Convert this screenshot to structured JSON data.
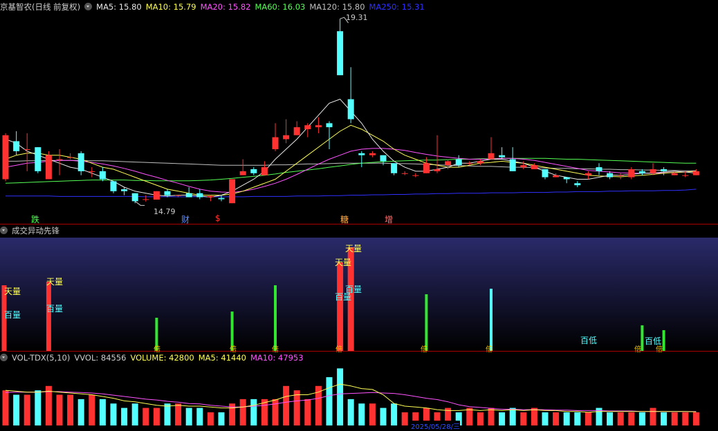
{
  "price_header": {
    "title": "京基智农(日线 前复权)",
    "ma5": "MA5: 15.80",
    "ma10": "MA10: 15.79",
    "ma20": "MA20: 15.82",
    "ma60": "MA60: 16.03",
    "ma120": "MA120: 15.80",
    "ma250": "MA250: 15.31"
  },
  "price_annotations": {
    "high": "19.31",
    "low": "14.79",
    "tags": [
      "跌",
      "财",
      "$",
      "糖",
      "增"
    ]
  },
  "indicator_header": {
    "title": "成交异动先锋"
  },
  "indicator_labels": {
    "tian": "天量",
    "bai": "百量",
    "bei": "倍",
    "baidi": "百低"
  },
  "volume_header": {
    "title": "VOL-TDX(5,10)",
    "vvol": "VVOL: 84556",
    "volume": "VOLUME: 42800",
    "ma5": "MA5: 41440",
    "ma10": "MA10: 47953"
  },
  "bottom_date": "2025/05/28/三",
  "colors": {
    "up": "#ff3232",
    "down": "#54ffff",
    "ma5": "#e8e8e8",
    "ma10": "#ffff54",
    "ma20": "#ff54ff",
    "ma60": "#54ff54",
    "ma120": "#c0c0c0",
    "ma250": "#3030ff",
    "separator": "#a00000"
  },
  "chart_data": {
    "type": "candlestick",
    "candles": [
      [
        15.3,
        16.4,
        16.45,
        15.25
      ],
      [
        16.25,
        16.0,
        16.5,
        15.9
      ],
      [
        16.05,
        16.05,
        16.45,
        15.5
      ],
      [
        16.1,
        15.5,
        16.1,
        15.45
      ],
      [
        15.3,
        15.9,
        16.0,
        15.3
      ],
      [
        15.8,
        15.8,
        16.05,
        15.4
      ],
      [
        15.85,
        15.85,
        15.95,
        15.8
      ],
      [
        15.95,
        15.5,
        16.0,
        15.4
      ],
      [
        15.5,
        15.5,
        15.6,
        15.35
      ],
      [
        15.5,
        15.3,
        15.6,
        15.25
      ],
      [
        15.25,
        15.0,
        15.25,
        14.95
      ],
      [
        15.05,
        15.0,
        15.1,
        14.9
      ],
      [
        14.95,
        14.75,
        14.95,
        14.7
      ],
      [
        14.8,
        14.8,
        14.9,
        14.74
      ],
      [
        14.79,
        15.0,
        15.0,
        14.79
      ],
      [
        15.0,
        14.9,
        15.05,
        14.85
      ],
      [
        14.9,
        14.9,
        14.9,
        14.85
      ],
      [
        14.95,
        14.85,
        15.1,
        14.85
      ],
      [
        14.95,
        14.85,
        15.05,
        14.8
      ],
      [
        14.85,
        14.88,
        14.9,
        14.75
      ],
      [
        14.83,
        14.8,
        14.9,
        14.75
      ],
      [
        14.7,
        15.3,
        15.3,
        14.7
      ],
      [
        15.4,
        15.5,
        15.8,
        15.4
      ],
      [
        15.55,
        15.45,
        15.6,
        15.4
      ],
      [
        15.4,
        15.6,
        15.75,
        15.4
      ],
      [
        16.05,
        16.35,
        16.7,
        16.0
      ],
      [
        16.3,
        16.4,
        16.8,
        16.2
      ],
      [
        16.4,
        16.6,
        16.75,
        16.4
      ],
      [
        16.55,
        16.65,
        16.7,
        16.35
      ],
      [
        16.6,
        16.65,
        16.85,
        16.45
      ],
      [
        16.7,
        16.6,
        16.75,
        16.05
      ],
      [
        19.0,
        17.9,
        19.31,
        17.9
      ],
      [
        17.3,
        16.8,
        18.1,
        16.7
      ],
      [
        15.95,
        15.9,
        16.0,
        15.6
      ],
      [
        15.9,
        15.95,
        16.0,
        15.85
      ],
      [
        15.9,
        15.75,
        15.9,
        15.65
      ],
      [
        15.7,
        15.45,
        15.7,
        15.4
      ],
      [
        15.45,
        15.45,
        15.5,
        15.4
      ],
      [
        15.4,
        15.4,
        15.45,
        15.35
      ],
      [
        15.45,
        15.7,
        15.85,
        15.45
      ],
      [
        15.5,
        15.55,
        16.4,
        15.45
      ],
      [
        15.65,
        15.75,
        15.8,
        15.55
      ],
      [
        15.8,
        15.65,
        15.9,
        15.6
      ],
      [
        15.7,
        15.7,
        15.75,
        15.65
      ],
      [
        15.7,
        15.75,
        15.8,
        15.65
      ],
      [
        15.8,
        15.95,
        16.35,
        15.8
      ],
      [
        15.9,
        15.85,
        16.1,
        15.8
      ],
      [
        15.8,
        15.5,
        16.1,
        15.5
      ],
      [
        15.6,
        15.65,
        15.75,
        15.55
      ],
      [
        15.55,
        15.65,
        15.7,
        15.55
      ],
      [
        15.55,
        15.35,
        15.55,
        15.3
      ],
      [
        15.35,
        15.4,
        15.45,
        15.35
      ],
      [
        15.35,
        15.3,
        15.35,
        15.2
      ],
      [
        15.2,
        15.15,
        15.25,
        15.1
      ],
      [
        15.4,
        15.45,
        15.5,
        15.3
      ],
      [
        15.6,
        15.5,
        15.7,
        15.4
      ],
      [
        15.45,
        15.35,
        15.5,
        15.3
      ],
      [
        15.4,
        15.4,
        15.45,
        15.3
      ],
      [
        15.35,
        15.55,
        15.6,
        15.3
      ],
      [
        15.5,
        15.45,
        15.55,
        15.4
      ],
      [
        15.45,
        15.55,
        15.7,
        15.4
      ],
      [
        15.55,
        15.5,
        15.6,
        15.4
      ],
      [
        15.4,
        15.45,
        15.5,
        15.4
      ],
      [
        15.4,
        15.4,
        15.5,
        15.35
      ],
      [
        15.4,
        15.5,
        15.55,
        15.4
      ]
    ],
    "ma5": [
      16.3,
      16.2,
      16.0,
      15.9,
      15.8,
      15.7,
      15.6,
      15.55,
      15.45,
      15.35,
      15.25,
      15.1,
      15.0,
      14.95,
      14.9,
      14.88,
      14.9,
      14.9,
      14.88,
      14.85,
      14.9,
      15.0,
      15.15,
      15.3,
      15.5,
      15.8,
      16.05,
      16.3,
      16.6,
      16.9,
      17.2,
      17.3,
      17.0,
      16.7,
      16.3,
      16.0,
      15.75,
      15.6,
      15.5,
      15.5,
      15.55,
      15.6,
      15.7,
      15.7,
      15.75,
      15.8,
      15.8,
      15.75,
      15.7,
      15.6,
      15.5,
      15.4,
      15.35,
      15.3,
      15.3,
      15.35,
      15.4,
      15.4,
      15.42,
      15.45,
      15.45,
      15.48,
      15.5,
      15.48,
      15.45
    ],
    "ma10": [
      15.8,
      15.9,
      15.95,
      15.95,
      15.9,
      15.9,
      15.85,
      15.8,
      15.7,
      15.6,
      15.55,
      15.45,
      15.35,
      15.25,
      15.15,
      15.05,
      15.0,
      14.95,
      14.9,
      14.9,
      14.9,
      14.93,
      15.0,
      15.1,
      15.2,
      15.3,
      15.5,
      15.7,
      15.9,
      16.1,
      16.3,
      16.5,
      16.65,
      16.55,
      16.4,
      16.25,
      16.05,
      15.9,
      15.8,
      15.7,
      15.65,
      15.6,
      15.6,
      15.65,
      15.7,
      15.72,
      15.75,
      15.72,
      15.7,
      15.65,
      15.6,
      15.55,
      15.5,
      15.45,
      15.4,
      15.38,
      15.37,
      15.36,
      15.38,
      15.4,
      15.42,
      15.45,
      15.47,
      15.48,
      15.5
    ],
    "ma20": [
      15.6,
      15.65,
      15.7,
      15.72,
      15.75,
      15.77,
      15.77,
      15.75,
      15.72,
      15.68,
      15.63,
      15.57,
      15.5,
      15.42,
      15.35,
      15.27,
      15.2,
      15.12,
      15.05,
      15.0,
      14.98,
      14.97,
      15.0,
      15.05,
      15.12,
      15.2,
      15.3,
      15.42,
      15.55,
      15.68,
      15.8,
      15.9,
      16.0,
      16.05,
      16.07,
      16.07,
      16.05,
      16.02,
      15.97,
      15.92,
      15.88,
      15.85,
      15.82,
      15.8,
      15.8,
      15.8,
      15.82,
      15.82,
      15.8,
      15.77,
      15.72,
      15.67,
      15.62,
      15.57,
      15.52,
      15.5,
      15.48,
      15.46,
      15.45,
      15.45,
      15.45,
      15.46,
      15.47,
      15.48,
      15.5
    ],
    "ma60": [
      15.2,
      15.21,
      15.22,
      15.23,
      15.24,
      15.25,
      15.26,
      15.27,
      15.28,
      15.28,
      15.28,
      15.28,
      15.27,
      15.27,
      15.26,
      15.26,
      15.26,
      15.26,
      15.27,
      15.28,
      15.3,
      15.32,
      15.35,
      15.37,
      15.4,
      15.43,
      15.47,
      15.5,
      15.53,
      15.56,
      15.6,
      15.63,
      15.67,
      15.7,
      15.72,
      15.74,
      15.75,
      15.76,
      15.77,
      15.78,
      15.78,
      15.79,
      15.8,
      15.8,
      15.81,
      15.81,
      15.82,
      15.82,
      15.82,
      15.82,
      15.82,
      15.81,
      15.8,
      15.8,
      15.79,
      15.78,
      15.77,
      15.76,
      15.75,
      15.74,
      15.73,
      15.72,
      15.71,
      15.7,
      15.7
    ],
    "ma120": [
      15.75,
      15.75,
      15.76,
      15.76,
      15.77,
      15.77,
      15.77,
      15.77,
      15.76,
      15.76,
      15.75,
      15.74,
      15.73,
      15.72,
      15.71,
      15.7,
      15.69,
      15.68,
      15.67,
      15.66,
      15.65,
      15.65,
      15.65,
      15.65,
      15.65,
      15.66,
      15.66,
      15.67,
      15.68,
      15.68,
      15.69,
      15.7,
      15.7,
      15.7,
      15.7,
      15.7,
      15.69,
      15.69,
      15.68,
      15.67,
      15.66,
      15.65,
      15.64,
      15.63,
      15.62,
      15.62,
      15.61,
      15.6,
      15.6,
      15.59,
      15.58,
      15.57,
      15.57,
      15.56,
      15.56,
      15.55,
      15.55,
      15.54,
      15.54,
      15.53,
      15.53,
      15.52,
      15.52,
      15.51,
      15.51
    ],
    "ma250": [
      14.88,
      14.88,
      14.88,
      14.88,
      14.88,
      14.87,
      14.87,
      14.87,
      14.87,
      14.87,
      14.87,
      14.87,
      14.87,
      14.86,
      14.86,
      14.86,
      14.86,
      14.86,
      14.86,
      14.86,
      14.86,
      14.86,
      14.86,
      14.87,
      14.87,
      14.87,
      14.87,
      14.88,
      14.88,
      14.88,
      14.89,
      14.89,
      14.9,
      14.9,
      14.91,
      14.91,
      14.92,
      14.92,
      14.93,
      14.93,
      14.94,
      14.94,
      14.95,
      14.95,
      14.95,
      14.96,
      14.96,
      14.96,
      14.97,
      14.97,
      14.97,
      14.98,
      14.98,
      14.99,
      14.99,
      14.99,
      15.0,
      15.0,
      15.01,
      15.01,
      15.01,
      15.02,
      15.02,
      15.03,
      15.05
    ],
    "volume": [
      8,
      7,
      7,
      8,
      9,
      7,
      7,
      6,
      7,
      6,
      5,
      4,
      5,
      4,
      4,
      5,
      5,
      4,
      4,
      3,
      3,
      5,
      6,
      6,
      6,
      6,
      9,
      8,
      6,
      9,
      11,
      13,
      6,
      5,
      5,
      4,
      5,
      3,
      3,
      4,
      3,
      4,
      3,
      4,
      3,
      4,
      3,
      4,
      3,
      4,
      3,
      3,
      3,
      3,
      3,
      4,
      3,
      3,
      3,
      3,
      4,
      3,
      3,
      3,
      3
    ],
    "vol_ma5": [
      8,
      7.8,
      7.6,
      7.6,
      7.8,
      7.6,
      7.4,
      7.2,
      7.0,
      6.6,
      6.2,
      5.6,
      5.4,
      5.0,
      4.6,
      4.4,
      4.6,
      4.4,
      4.4,
      4.2,
      4.0,
      4.0,
      4.2,
      4.6,
      5.2,
      5.8,
      6.6,
      7.0,
      7.0,
      7.6,
      8.6,
      9.4,
      9.0,
      8.4,
      8.2,
      7.0,
      5.0,
      4.4,
      4.2,
      4.0,
      3.6,
      3.4,
      3.4,
      3.6,
      3.4,
      3.6,
      3.4,
      3.6,
      3.4,
      3.6,
      3.4,
      3.4,
      3.2,
      3.2,
      3.0,
      3.2,
      3.2,
      3.2,
      3.2,
      3.2,
      3.2,
      3.2,
      3.2,
      3.2,
      3.1
    ],
    "vol_ma10": [
      7.5,
      7.6,
      7.6,
      7.6,
      7.7,
      7.7,
      7.6,
      7.5,
      7.4,
      7.2,
      6.9,
      6.6,
      6.3,
      6.0,
      5.8,
      5.5,
      5.3,
      5.0,
      4.9,
      4.6,
      4.4,
      4.2,
      4.2,
      4.4,
      4.6,
      4.9,
      5.3,
      5.6,
      5.8,
      6.2,
      6.8,
      7.2,
      7.3,
      7.4,
      7.5,
      7.4,
      7.3,
      7.0,
      6.6,
      6.2,
      5.9,
      5.4,
      4.7,
      4.3,
      4.1,
      3.9,
      3.7,
      3.7,
      3.6,
      3.6,
      3.6,
      3.5,
      3.5,
      3.4,
      3.4,
      3.4,
      3.3,
      3.3,
      3.3,
      3.2,
      3.2,
      3.2,
      3.2,
      3.2,
      3.2
    ]
  }
}
